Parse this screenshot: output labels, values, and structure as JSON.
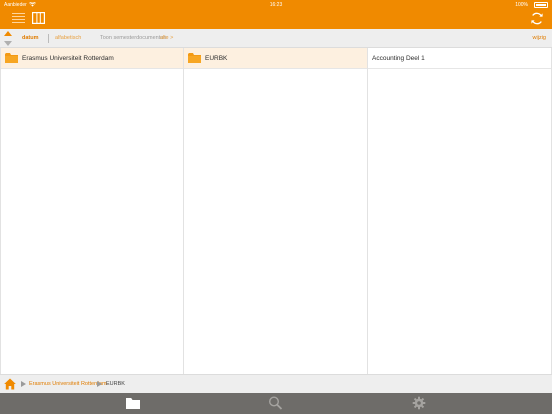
{
  "status_bar": {
    "carrier": "Aanbieder",
    "time": "16:23",
    "battery_text": "100%"
  },
  "header": {
    "menu_icon": "hamburger-menu-icon",
    "columns_icon": "columns-view-icon",
    "refresh_icon": "refresh-icon"
  },
  "sort_bar": {
    "sort_datum": "datum",
    "sort_alpha": "alfabetisch",
    "show_label": "Toon semesterdocumenten:",
    "show_value": "alle >",
    "edit_label": "wijzig"
  },
  "columns": [
    {
      "items": [
        {
          "label": "Erasmus Universiteit Rotterdam",
          "type": "folder",
          "selected": true
        }
      ]
    },
    {
      "items": [
        {
          "label": "EURBK",
          "type": "folder",
          "selected": true
        }
      ]
    },
    {
      "items": [
        {
          "label": "Accounting Deel 1",
          "type": "item",
          "selected": false
        }
      ]
    }
  ],
  "breadcrumb": {
    "items": [
      "Erasmus Universiteit Rotterdam",
      "EURBK"
    ]
  },
  "tab_bar": {
    "tabs": [
      {
        "name": "files",
        "icon": "folder-icon",
        "active": true
      },
      {
        "name": "search",
        "icon": "search-icon",
        "active": false
      },
      {
        "name": "settings",
        "icon": "gear-icon",
        "active": false
      }
    ]
  },
  "colors": {
    "accent": "#f08a00",
    "selection": "#fdf0e0",
    "tabbar": "#6e6c69"
  }
}
